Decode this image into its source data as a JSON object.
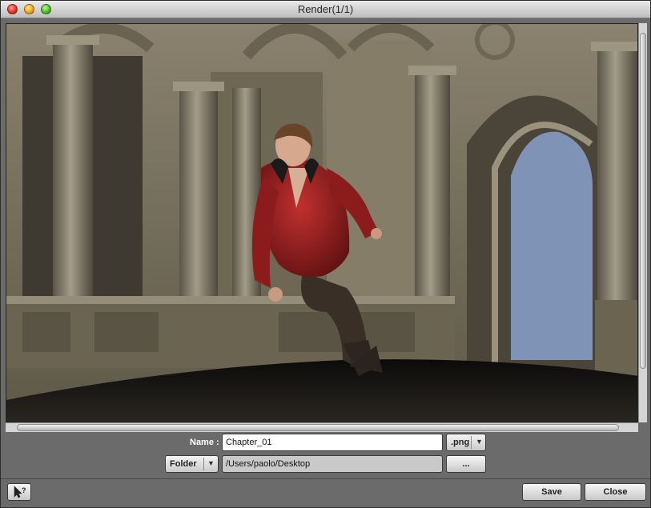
{
  "window": {
    "title": "Render(1/1)"
  },
  "output": {
    "name_label": "Name :",
    "name_value": "Chapter_01",
    "format_value": ".png",
    "location_type": "Folder",
    "path_value": "/Users/paolo/Desktop",
    "browse_label": "..."
  },
  "footer": {
    "save_label": "Save",
    "close_label": "Close"
  },
  "icons": {
    "help": "help-pointer-icon",
    "dropdown": "chevron-down-icon",
    "window_controls": [
      "close-icon",
      "minimize-icon",
      "zoom-icon"
    ]
  },
  "colors": {
    "window_bg": "#6b6b6b",
    "sky": "#7e93b6",
    "jacket": "#8c1c1c",
    "stone": "#7a7260"
  }
}
